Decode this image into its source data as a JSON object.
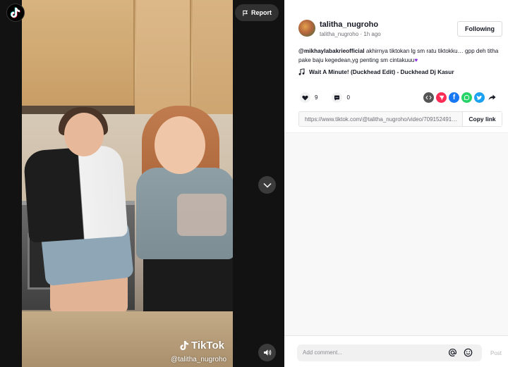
{
  "app": {
    "name": "TikTok"
  },
  "video": {
    "report_label": "Report",
    "watermark_brand": "TikTok",
    "watermark_user": "@talitha_nugroho"
  },
  "post": {
    "username": "talitha_nugroho",
    "subline": "talitha_nugroho · 1h ago",
    "follow_label": "Following",
    "caption_mention": "@mikhaylabakrieofficial",
    "caption_text": " akhirnya tiktokan lg sm ratu tiktokku… gpp deh titha pake baju kegedean,yg penting sm cintakuuu",
    "music": "Wait A Minute! (Duckhead Edit) - Duckhead Dj Kasur",
    "likes": "9",
    "comments": "0",
    "link_url": "https://www.tiktok.com/@talitha_nugroho/video/709152491…",
    "copy_link_label": "Copy link"
  },
  "share_icons": [
    "embed-icon",
    "send-icon",
    "facebook-icon",
    "whatsapp-icon",
    "twitter-icon",
    "share-arrow-icon"
  ],
  "comment_bar": {
    "placeholder": "Add comment...",
    "post_label": "Post"
  },
  "colors": {
    "video_bg": "#121212",
    "heart_emoji": "#8a2be2",
    "facebook": "#1877f2",
    "whatsapp": "#25d366",
    "twitter": "#1da1f2",
    "send": "#fe2c55",
    "embed": "#555555"
  }
}
